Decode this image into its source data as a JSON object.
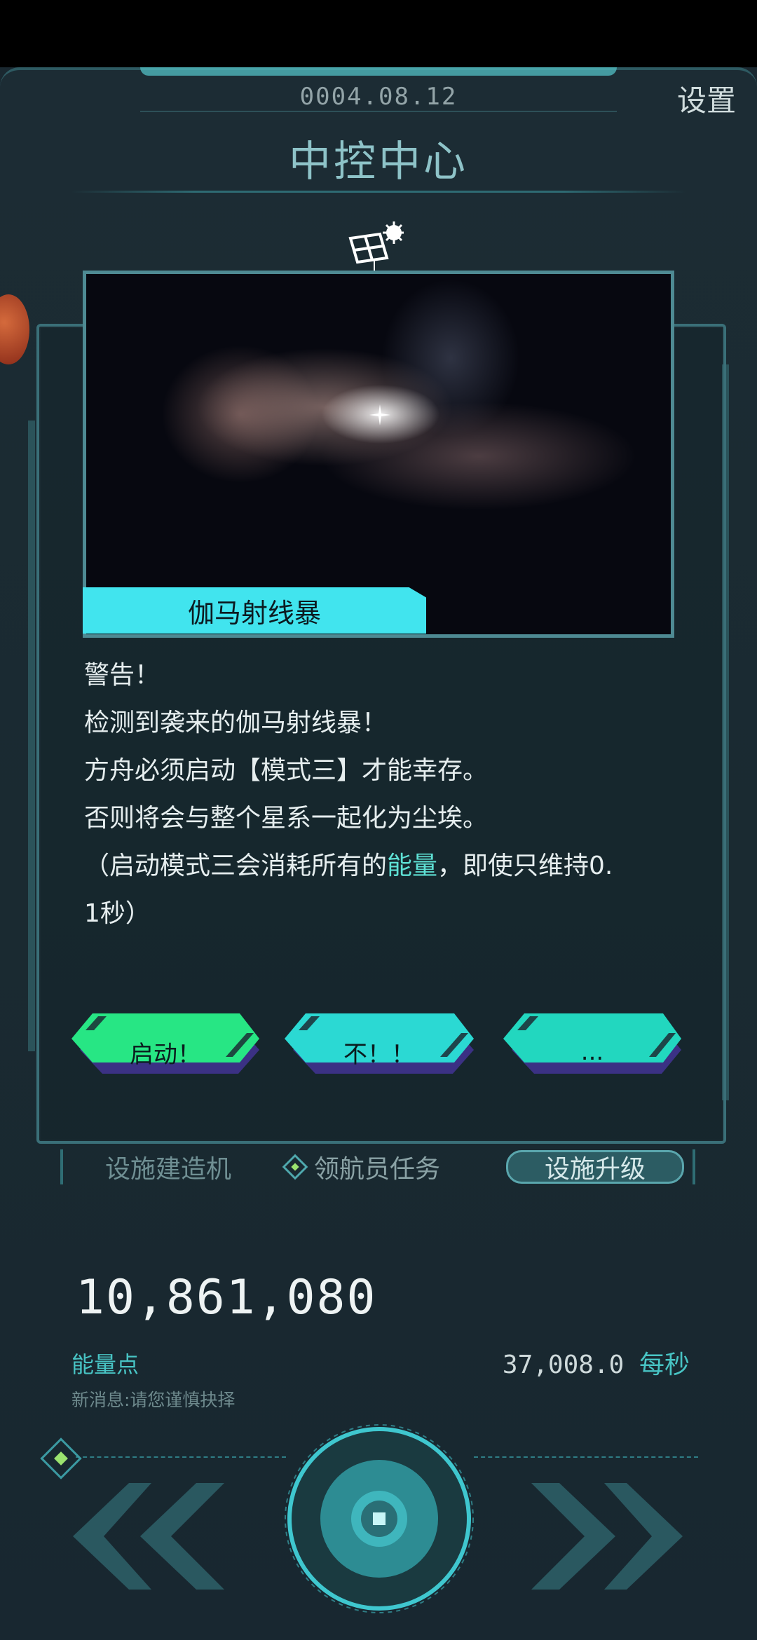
{
  "header": {
    "date": "0004.08.12",
    "settings_label": "设置",
    "title": "中控中心"
  },
  "event": {
    "image_caption": "伽马射线暴",
    "message_lines": [
      "警告！",
      "检测到袭来的伽马射线暴！",
      "方舟必须启动【模式三】才能幸存。",
      "否则将会与整个星系一起化为尘埃。"
    ],
    "last_line_prefix": "（启动模式三会消耗所有的",
    "last_line_highlight": "能量",
    "last_line_suffix": "，即使只维持0.",
    "last_line_wrap": "1秒）",
    "choices": {
      "start": "启动！",
      "no": "不！！",
      "more": "..."
    }
  },
  "tabs": {
    "build": "设施建造机",
    "navigator": "领航员任务",
    "upgrade": "设施升级"
  },
  "stats": {
    "energy_value": "10,861,080",
    "energy_label": "能量点",
    "rate_value": "37,008.0",
    "rate_unit": "每秒",
    "news": "新消息:请您谨慎抉择"
  },
  "colors": {
    "accent": "#41e4ee",
    "start_button": "#27e684",
    "no_button": "#2bd9d3",
    "more_button": "#22d7bf",
    "button_shadow": "#3b3184"
  },
  "icons": [
    "satellite-icon",
    "double-chevron-left-icon",
    "double-chevron-right-icon",
    "center-core-button-icon",
    "diamond-marker-icon"
  ]
}
